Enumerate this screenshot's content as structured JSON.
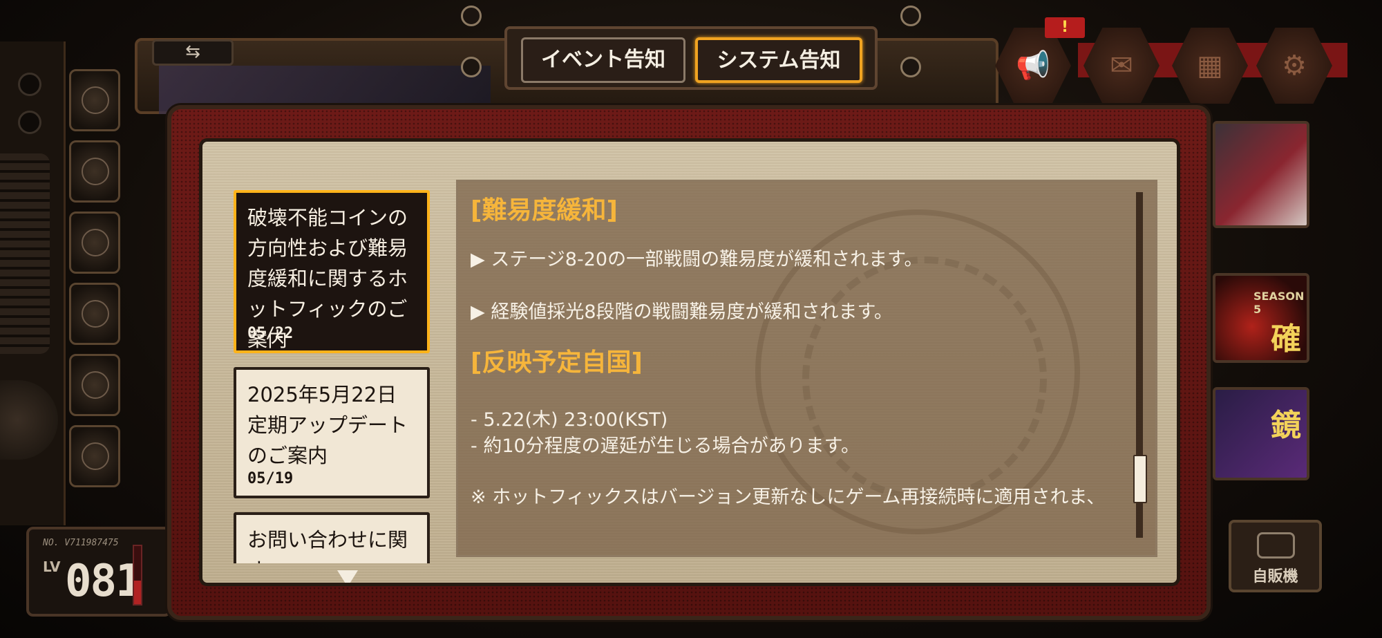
{
  "tabs": {
    "event": "イベント告知",
    "system": "システム告知"
  },
  "notices": [
    {
      "title": "破壊不能コインの方向性および難易度緩和に関するホットフィックのご案内",
      "date": "05/22",
      "selected": true
    },
    {
      "title": "2025年5月22日 定期アップデートのご案内",
      "date": "05/19",
      "selected": false
    },
    {
      "title": "お問い合わせに関す",
      "date": "",
      "selected": false
    }
  ],
  "content": {
    "heading1": "[難易度緩和]",
    "bullet1": "▶ ステージ8-20の一部戦闘の難易度が緩和されます。",
    "bullet2": "▶ 経験値採光8段階の戦闘難易度が緩和されます。",
    "heading2": "[反映予定自国]",
    "schedule1": "- 5.22(木) 23:00(KST)",
    "schedule2": "- 約10分程度の遅延が生じる場合があります。",
    "note": "※ ホットフィックスはバージョン更新なしにゲーム再接続時に適用されま、"
  },
  "player": {
    "number": "NO. V711987475",
    "lv_label": "LV",
    "level": "081"
  },
  "header": {
    "swap_icon": "⇆",
    "alert_icon": "!"
  },
  "right_cards": {
    "season_label": "SEASON 5",
    "card2_glyph": "確",
    "card3_glyph": "鏡"
  },
  "vending_label": "自販機",
  "icons": {
    "megaphone": "megaphone-icon",
    "mail": "mail-icon",
    "chest": "chest-icon",
    "settings": "gear-icon"
  },
  "colors": {
    "accent_orange": "#ffb31a",
    "heading_gold": "#f6b53b",
    "modal_red": "#6d1a17"
  }
}
